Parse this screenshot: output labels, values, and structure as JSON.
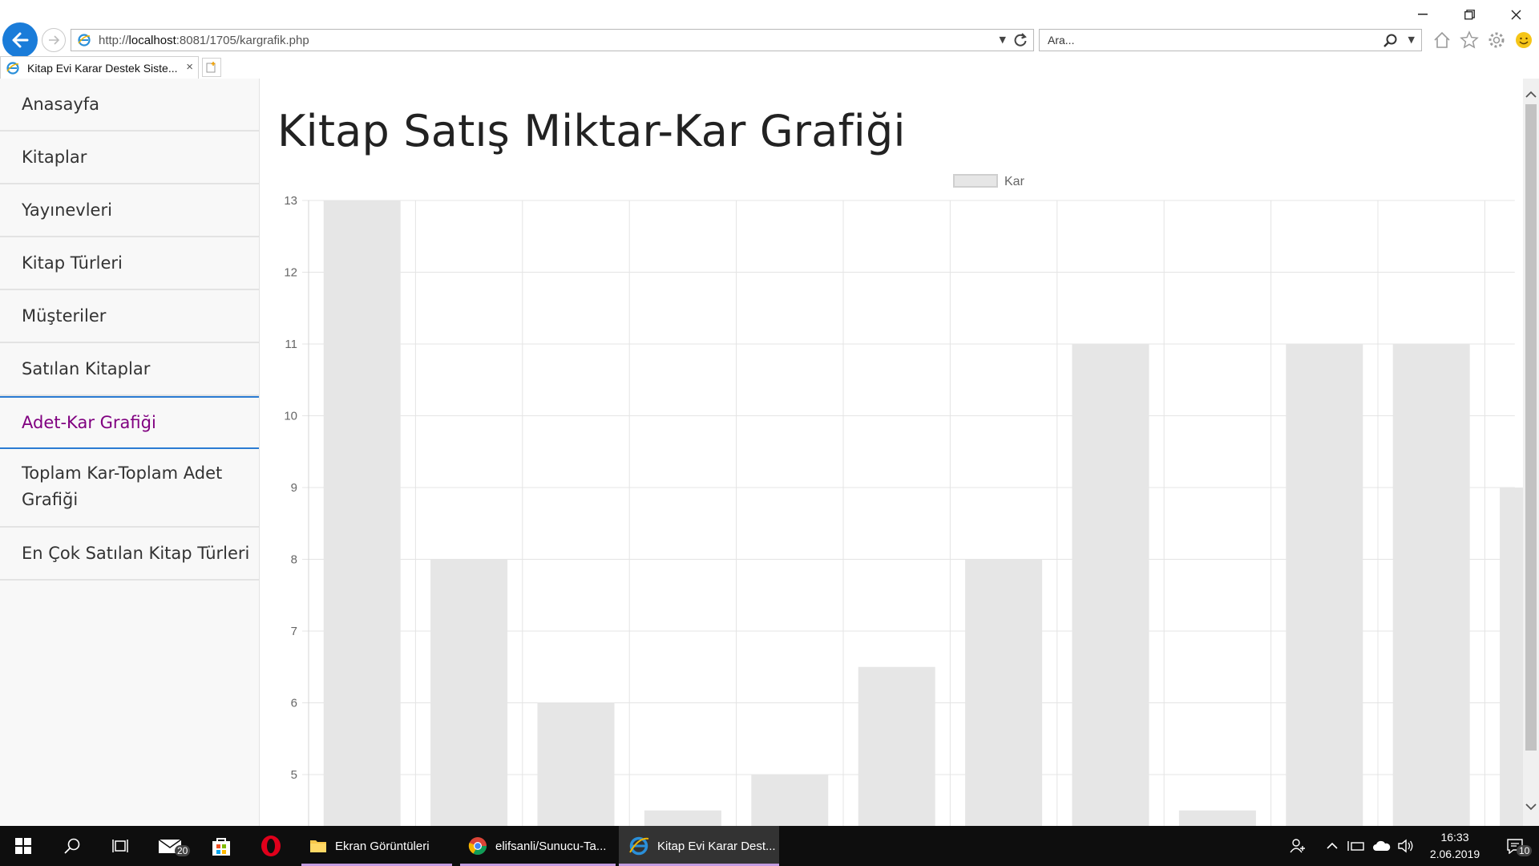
{
  "browser": {
    "url_prefix": "http://",
    "url_host": "localhost",
    "url_rest": ":8081/1705/kargrafik.php",
    "search_placeholder": "Ara...",
    "tab_title": "Kitap Evi Karar Destek Siste...",
    "tab_close": "×"
  },
  "sidebar": {
    "items": [
      {
        "label": "Anasayfa"
      },
      {
        "label": "Kitaplar"
      },
      {
        "label": "Yayınevleri"
      },
      {
        "label": "Kitap Türleri"
      },
      {
        "label": "Müşteriler"
      },
      {
        "label": "Satılan Kitaplar"
      },
      {
        "label": "Adet-Kar Grafiği",
        "active": true
      },
      {
        "label": "Toplam Kar-Toplam Adet Grafiği"
      },
      {
        "label": "En Çok Satılan Kitap Türleri"
      }
    ]
  },
  "page": {
    "title": "Kitap Satış Miktar-Kar Grafiği"
  },
  "chart_data": {
    "type": "bar",
    "series": [
      {
        "name": "Kar",
        "color": "#e6e6e6",
        "values": [
          13,
          8,
          6,
          4.5,
          5,
          6.5,
          8,
          11,
          4.5,
          11,
          11,
          9
        ]
      }
    ],
    "yticks": [
      5,
      6,
      7,
      8,
      9,
      10,
      11,
      12,
      13
    ],
    "ylim_visible": [
      4.3,
      13
    ],
    "legend_position": "top-center",
    "grid": true
  },
  "taskbar": {
    "apps": [
      {
        "label": "Ekran Görüntüleri"
      },
      {
        "label": "elifsanli/Sunucu-Ta..."
      },
      {
        "label": "Kitap Evi Karar Dest..."
      }
    ],
    "mail_badge": "20",
    "notif_badge": "10",
    "time": "16:33",
    "date": "2.06.2019"
  }
}
